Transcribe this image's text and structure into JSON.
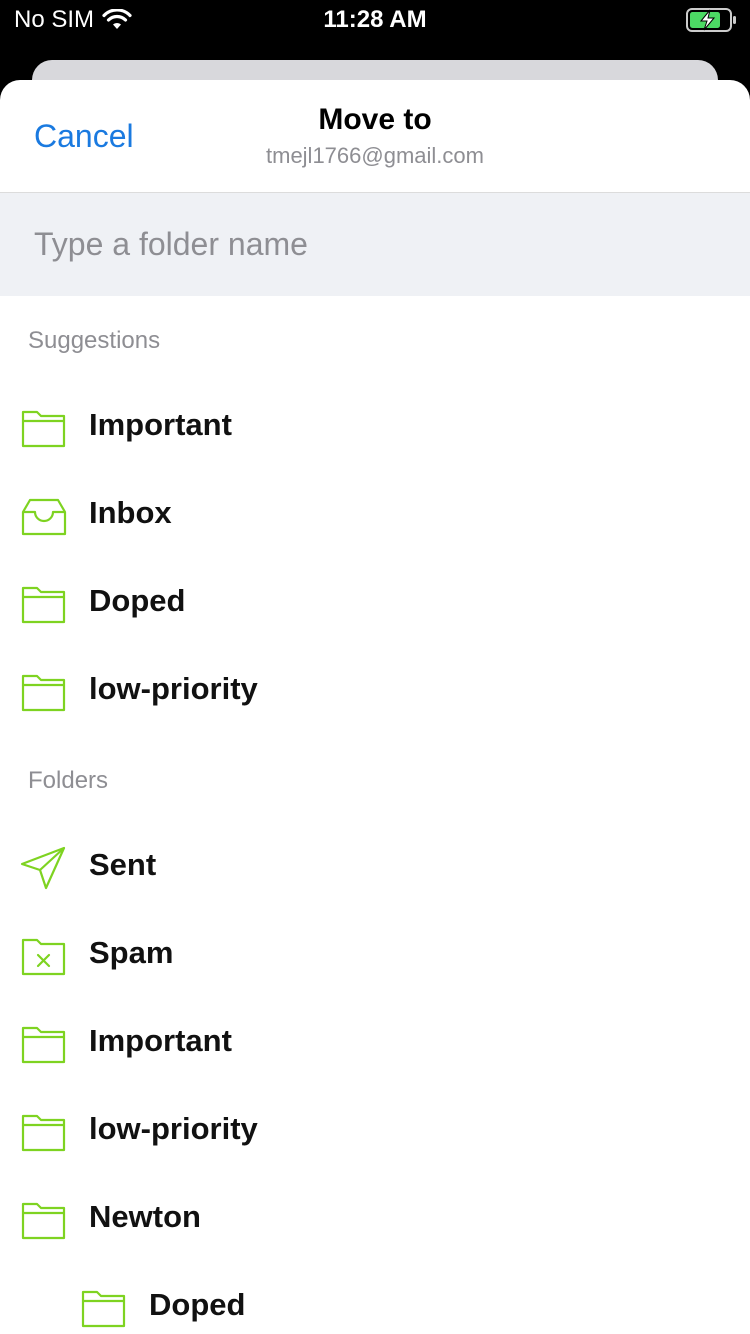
{
  "status_bar": {
    "carrier": "No SIM",
    "time": "11:28 AM",
    "wifi_icon": "wifi-icon",
    "battery_icon": "battery-charging-icon"
  },
  "nav": {
    "cancel_label": "Cancel",
    "title": "Move to",
    "account": "tmejl1766@gmail.com"
  },
  "search": {
    "placeholder": "Type a folder name",
    "value": ""
  },
  "suggestions": {
    "header": "Suggestions",
    "items": [
      {
        "label": "Important",
        "icon": "folder-icon"
      },
      {
        "label": "Inbox",
        "icon": "inbox-icon"
      },
      {
        "label": "Doped",
        "icon": "folder-icon"
      },
      {
        "label": "low-priority",
        "icon": "folder-icon"
      }
    ]
  },
  "folders": {
    "header": "Folders",
    "items": [
      {
        "label": "Sent",
        "icon": "paper-plane-icon"
      },
      {
        "label": "Spam",
        "icon": "spam-folder-icon"
      },
      {
        "label": "Important",
        "icon": "folder-icon"
      },
      {
        "label": "low-priority",
        "icon": "folder-icon"
      },
      {
        "label": "Newton",
        "icon": "folder-icon"
      },
      {
        "label": "Doped",
        "icon": "folder-icon"
      }
    ]
  },
  "colors": {
    "accent": "#1a7ae0",
    "icon_green": "#7ed321",
    "secondary_text": "#8e8e93",
    "search_bg": "#eff1f5"
  }
}
